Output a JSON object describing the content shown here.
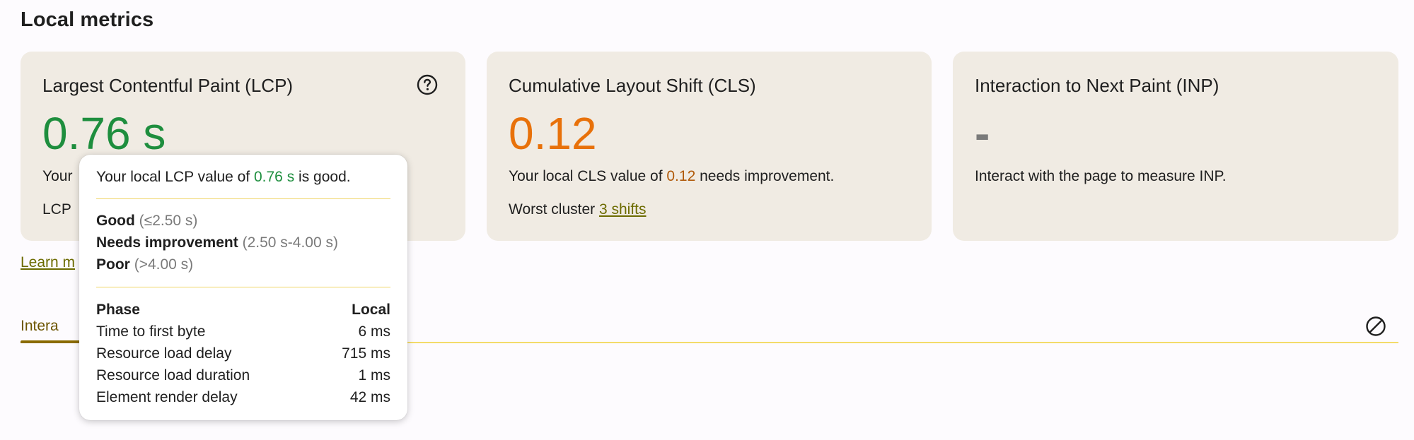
{
  "section_title": "Local metrics",
  "cards": {
    "lcp": {
      "title": "Largest Contentful Paint (LCP)",
      "value": "0.76 s",
      "line1_prefix": "Your",
      "line2_prefix": "LCP",
      "value_color": "#1e8e3e"
    },
    "cls": {
      "title": "Cumulative Layout Shift (CLS)",
      "value": "0.12",
      "desc_prefix": "Your local CLS value of ",
      "desc_value": "0.12",
      "desc_suffix": " needs improvement.",
      "worst_label": "Worst cluster ",
      "worst_link": "3 shifts",
      "value_color": "#e8710a"
    },
    "inp": {
      "title": "Interaction to Next Paint (INP)",
      "value": "-",
      "desc": "Interact with the page to measure INP."
    }
  },
  "learn_more": "Learn m",
  "tab_label": "Intera",
  "tooltip": {
    "head_prefix": "Your local LCP value of ",
    "head_value": "0.76 s",
    "head_suffix": " is good.",
    "ratings": [
      {
        "label": "Good",
        "range": "(≤2.50 s)"
      },
      {
        "label": "Needs improvement",
        "range": "(2.50 s-4.00 s)"
      },
      {
        "label": "Poor",
        "range": "(>4.00 s)"
      }
    ],
    "table": {
      "col_phase": "Phase",
      "col_local": "Local",
      "rows": [
        {
          "phase": "Time to first byte",
          "local": "6 ms"
        },
        {
          "phase": "Resource load delay",
          "local": "715 ms"
        },
        {
          "phase": "Resource load duration",
          "local": "1 ms"
        },
        {
          "phase": "Element render delay",
          "local": "42 ms"
        }
      ]
    }
  },
  "icons": {
    "help": "help-circle-icon",
    "clear": "clear-block-icon"
  },
  "colors": {
    "good": "#1e8e3e",
    "needs_improvement": "#e8710a",
    "link": "#6c6b00",
    "card_bg": "#f0ebe3",
    "divider": "#f0d567"
  }
}
